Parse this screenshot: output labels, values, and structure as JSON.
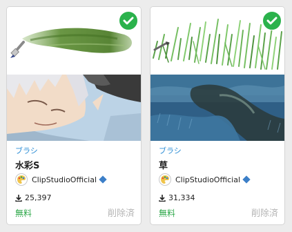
{
  "cards": [
    {
      "category": "ブラシ",
      "title": "水彩S",
      "author": "ClipStudioOfficial",
      "downloads": "25,397",
      "price": "無料",
      "status": "削除済",
      "selected": true
    },
    {
      "category": "ブラシ",
      "title": "草",
      "author": "ClipStudioOfficial",
      "downloads": "31,334",
      "price": "無料",
      "status": "削除済",
      "selected": true
    }
  ],
  "colors": {
    "accent_blue": "#2f8fd6",
    "check_green": "#2bb24c",
    "price_green": "#2ea84a",
    "muted_gray": "#b5b5b5",
    "verified_blue": "#3c7fc8"
  },
  "icons": {
    "selected": "check-circle-icon",
    "verified": "diamond-icon",
    "download": "download-icon",
    "brush_tool": "brush-icon"
  }
}
